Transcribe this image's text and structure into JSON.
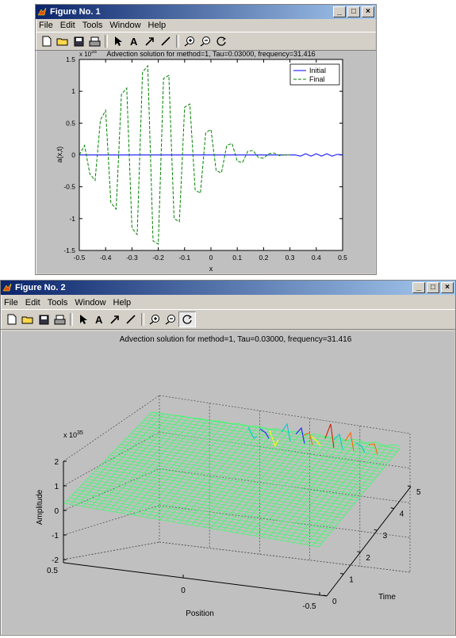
{
  "colors": {
    "titlebar_start": "#0a246a",
    "initial_line": "#0000ff",
    "final_line": "#008000",
    "mesh": "#33ff66"
  },
  "window1": {
    "title": "Figure No. 1",
    "menu": [
      "File",
      "Edit",
      "Tools",
      "Window",
      "Help"
    ],
    "toolbar_icons": [
      "new-icon",
      "open-icon",
      "save-icon",
      "print-icon",
      "pointer-icon",
      "text-icon",
      "arrow-icon",
      "line-icon",
      "zoom-in-icon",
      "zoom-out-icon",
      "rotate-icon"
    ],
    "plot": {
      "title": "Advection solution for method=1, Tau=0.03000, frequency=31.416",
      "exponent": "x 10",
      "exponent_power": "35",
      "xlabel": "x",
      "ylabel": "a(x,t)",
      "xticks": [
        "-0.5",
        "-0.4",
        "-0.3",
        "-0.2",
        "-0.1",
        "0",
        "0.1",
        "0.2",
        "0.3",
        "0.4",
        "0.5"
      ],
      "yticks": [
        "-1.5",
        "-1",
        "-0.5",
        "0",
        "0.5",
        "1",
        "1.5"
      ],
      "legend": [
        "Initial",
        "Final"
      ]
    }
  },
  "window2": {
    "title": "Figure No. 2",
    "menu": [
      "File",
      "Edit",
      "Tools",
      "Window",
      "Help"
    ],
    "plot": {
      "title": "Advection solution for method=1, Tau=0.03000, frequency=31.416",
      "exponent": "x 10",
      "exponent_power": "35",
      "zlabel": "Amplitude",
      "xlabel": "Position",
      "ylabel": "Time",
      "zticks": [
        "-2",
        "-1",
        "0",
        "1",
        "2"
      ],
      "xticks": [
        "0.5",
        "0",
        "-0.5"
      ],
      "yticks": [
        "0",
        "1",
        "2",
        "3",
        "4",
        "5"
      ]
    }
  },
  "chart_data": [
    {
      "type": "line",
      "title": "Advection solution for method=1, Tau=0.03000, frequency=31.416",
      "xlabel": "x",
      "ylabel": "a(x,t)",
      "xlim": [
        -0.5,
        0.5
      ],
      "ylim": [
        -1.5,
        1.5
      ],
      "y_multiplier": "1e35",
      "legend_position": "top-right",
      "series": [
        {
          "name": "Initial",
          "x": [
            -0.5,
            -0.4,
            -0.3,
            -0.2,
            -0.1,
            0,
            0.1,
            0.2,
            0.28,
            0.32,
            0.34,
            0.36,
            0.38,
            0.4,
            0.42,
            0.44,
            0.46,
            0.48,
            0.5
          ],
          "y": [
            0,
            0,
            0,
            0,
            0,
            0,
            0,
            0,
            0,
            0,
            -0.02,
            0.02,
            -0.02,
            0.02,
            -0.02,
            0.02,
            -0.02,
            0.01,
            0
          ]
        },
        {
          "name": "Final",
          "x": [
            -0.5,
            -0.48,
            -0.46,
            -0.44,
            -0.42,
            -0.4,
            -0.38,
            -0.36,
            -0.34,
            -0.32,
            -0.3,
            -0.28,
            -0.26,
            -0.24,
            -0.22,
            -0.2,
            -0.18,
            -0.16,
            -0.14,
            -0.12,
            -0.1,
            -0.08,
            -0.06,
            -0.04,
            -0.02,
            0,
            0.02,
            0.04,
            0.06,
            0.08,
            0.1,
            0.12,
            0.14,
            0.16,
            0.18,
            0.2,
            0.22,
            0.24,
            0.26,
            0.28,
            0.3
          ],
          "y": [
            0,
            0.15,
            -0.3,
            -0.4,
            0.55,
            0.7,
            -0.75,
            -0.85,
            0.95,
            1.05,
            -1.15,
            -1.25,
            1.3,
            1.4,
            -1.35,
            -1.4,
            1.2,
            1.25,
            -1.0,
            -1.05,
            0.75,
            0.8,
            -0.55,
            -0.6,
            0.35,
            0.4,
            -0.25,
            -0.28,
            0.15,
            0.18,
            -0.1,
            -0.12,
            0.06,
            0.07,
            -0.04,
            -0.05,
            0.02,
            0.03,
            -0.01,
            0,
            0
          ]
        }
      ]
    },
    {
      "type": "surface",
      "title": "Advection solution for method=1, Tau=0.03000, frequency=31.416",
      "xlabel": "Position",
      "ylabel": "Time",
      "zlabel": "Amplitude",
      "xlim": [
        -0.5,
        0.5
      ],
      "ylim": [
        0,
        5
      ],
      "zlim": [
        -2,
        2
      ],
      "z_multiplier": "1e35",
      "grid": true
    }
  ]
}
